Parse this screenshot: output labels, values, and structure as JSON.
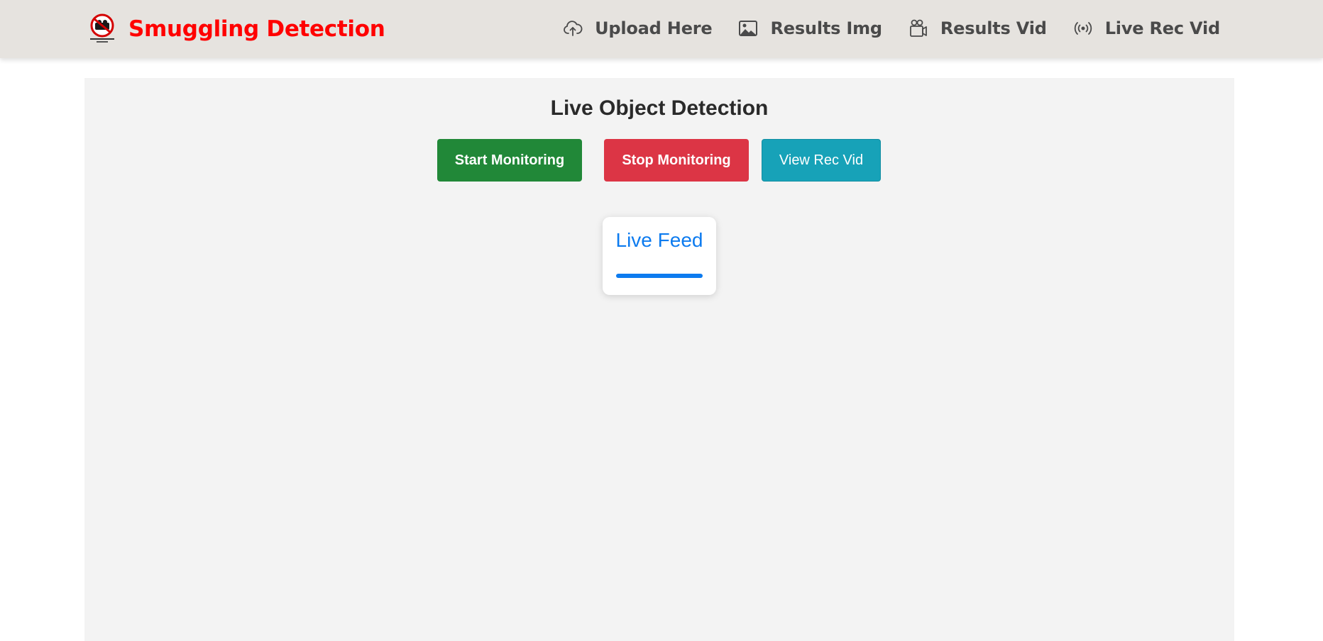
{
  "navbar": {
    "brand": {
      "logo_icon": "anti-detection-logo-icon",
      "title": "Smuggling Detection",
      "title_color": "#ff0000"
    },
    "links": [
      {
        "label": "Upload Here",
        "icon": "cloud-upload-icon"
      },
      {
        "label": "Results Img",
        "icon": "image-icon"
      },
      {
        "label": "Results Vid",
        "icon": "video-camera-icon"
      },
      {
        "label": "Live Rec Vid",
        "icon": "broadcast-icon"
      }
    ]
  },
  "main": {
    "title": "Live Object Detection",
    "buttons": {
      "start_label": "Start Monitoring",
      "start_color": "#218838",
      "stop_label": "Stop Monitoring",
      "stop_color": "#dc3545",
      "view_label": "View Rec Vid",
      "view_color": "#17a2b8"
    },
    "feed": {
      "title": "Live Feed",
      "accent_color": "#0d7bef"
    }
  }
}
